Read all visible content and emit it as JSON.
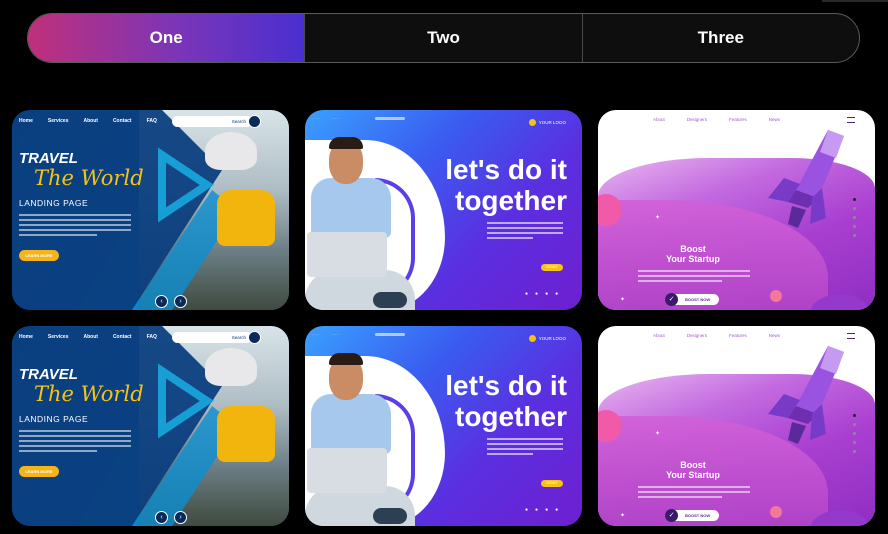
{
  "tabs": [
    {
      "label": "One",
      "active": true
    },
    {
      "label": "Two",
      "active": false
    },
    {
      "label": "Three",
      "active": false
    }
  ],
  "travel": {
    "nav": [
      "Home",
      "Services",
      "About",
      "Contact",
      "FAQ"
    ],
    "search_label": "Search",
    "title_line1": "TRAVEL",
    "title_line2": "The World",
    "subtitle": "LANDING PAGE",
    "cta": "LEARN MORE",
    "prev_icon": "chevron-left-icon",
    "next_icon": "chevron-right-icon"
  },
  "together": {
    "logo": "YOUR LOGO",
    "headline_line1": "let's do it",
    "headline_line2": "together",
    "cta": "START"
  },
  "startup": {
    "nav": [
      "About",
      "Designers",
      "Features",
      "News"
    ],
    "headline_line1": "Boost",
    "headline_line2": "Your Startup",
    "cta": "BOOST NOW"
  },
  "colors": {
    "tab_active_start": "#c0307a",
    "tab_active_end": "#4a2fd0",
    "travel_accent": "#f5c218",
    "together_accent": "#5a2fe0",
    "startup_accent": "#a93fd0"
  }
}
